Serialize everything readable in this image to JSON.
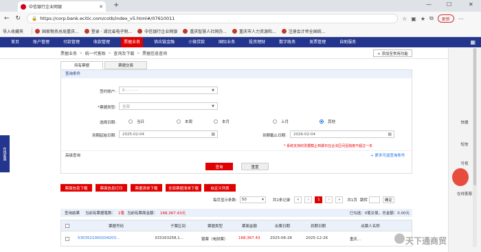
{
  "browser": {
    "tab_title": "中信银行企业网银",
    "url": "https://corp.bank.ecitic.com/cotb/index_v5.html#/07610011",
    "update_label": "更新",
    "bookmarks": [
      "导入收藏夹",
      "国家税务总局重庆...",
      "登录 · 湖北省电子税...",
      "中信银行企业网银",
      "重庆智慧人社网办...",
      "重庆市人力资源和...",
      "注册会计师全国统..."
    ]
  },
  "topnav": {
    "items": [
      "首页",
      "账户管理",
      "付款管理",
      "收款管理",
      "票据业务",
      "供应链金融",
      "小微贷款",
      "国际业务",
      "投资理财",
      "数字政务",
      "发票管理",
      "自助服务"
    ],
    "active_index": 4
  },
  "breadcrumb": {
    "items": [
      "票据业务",
      "统一代客账",
      "查询及下载",
      "票据信息查询"
    ],
    "add_shortcut": "+ 添加至常用功能"
  },
  "subtabs": [
    "持有票据",
    "票据交易"
  ],
  "query": {
    "section_title": "查询条件",
    "account_label": "签约账户:",
    "account_value": "8···········",
    "type_label": "*票据类型:",
    "type_value": "全部",
    "date_select_label": "选择日期:",
    "radios": [
      "当日",
      "本周",
      "本月",
      "上月",
      "其他"
    ],
    "radio_selected": 4,
    "start_label": "到期起始日期:",
    "start_value": "2025-02-04",
    "end_label": "到期截止日期:",
    "end_value": "2026-02-04",
    "note": "* 系统支持的票据截止到期日在合法区间且跨度不超过一年",
    "advanced": "高级查询",
    "more_conditions": "+ 更多可选查询条件",
    "search_btn": "查询",
    "reset_btn": "重置"
  },
  "actions": [
    "票面信息下载",
    "票面信息打印",
    "票据清单下载",
    "全部票据清单下载",
    "自定义列表"
  ],
  "pager": {
    "per_page_label": "每页显示条数:",
    "per_page": "50",
    "total_pages": "共1条记录",
    "first": "«",
    "prev": "‹",
    "page": "1",
    "next": "›",
    "last": "»",
    "total_label": "共1页",
    "goto_label": "跳转",
    "go_btn": "确定"
  },
  "result": {
    "title": "查询结果",
    "count_text": "当前有票据笔数：",
    "count": "1笔",
    "amount_text": "当前有票面金额：",
    "amount": "168,367.43元",
    "selected_text": "已勾选：0笔交易，总金额：0.00元"
  },
  "table": {
    "headers": [
      "票据号码",
      "子票区间",
      "票据类型",
      "票面金额",
      "出票日期",
      "到期日期",
      "出票人名称"
    ],
    "rows": [
      [
        "5303521000204203...",
        "333163258,1...",
        "银票（电财票）",
        "168,367.43",
        "2025-06-26",
        "2025-12-26",
        "重庆..."
      ]
    ]
  },
  "sidebar_right": [
    "快捷",
    "短信",
    "可视",
    "在线客服"
  ],
  "left_widget": "在线客服",
  "watermark": "天下通商贸"
}
